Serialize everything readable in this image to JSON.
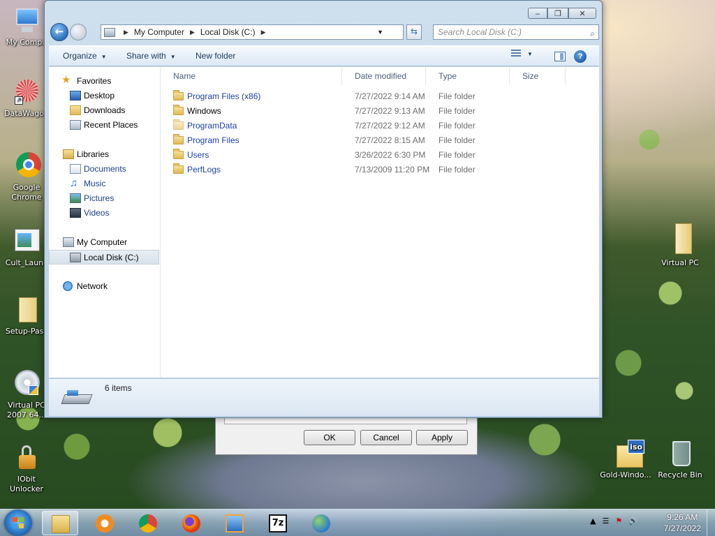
{
  "desktop": {
    "icons_left": [
      {
        "label": "My Compu",
        "icon": "my-computer-icon"
      },
      {
        "label": "DataWagon",
        "icon": "datawagon-icon"
      },
      {
        "label": "Google Chrome",
        "icon": "chrome-icon"
      },
      {
        "label": "Cult_Launc",
        "icon": "app-window-icon"
      },
      {
        "label": "Setup-Pass",
        "icon": "folder-icon"
      },
      {
        "label": "Virtual PC 2007 64...",
        "icon": "disc-installer-icon"
      },
      {
        "label": "IObit Unlocker",
        "icon": "unlocker-lock-icon"
      }
    ],
    "icons_right": [
      {
        "label": "Virtual PC",
        "icon": "folder-icon"
      },
      {
        "label": "Gold-Windo...",
        "icon": "iso-file-icon"
      },
      {
        "label": "Recycle Bin",
        "icon": "recycle-bin-icon"
      }
    ]
  },
  "back_dialog": {
    "ok": "OK",
    "cancel": "Cancel",
    "apply": "Apply"
  },
  "explorer": {
    "address": [
      "My Computer",
      "Local Disk (C:)"
    ],
    "search_placeholder": "Search Local Disk (C:)",
    "toolbar": {
      "organize": "Organize",
      "share_with": "Share with",
      "new_folder": "New folder"
    },
    "sidebar": {
      "favorites": {
        "label": "Favorites",
        "items": [
          "Desktop",
          "Downloads",
          "Recent Places"
        ]
      },
      "libraries": {
        "label": "Libraries",
        "items": [
          "Documents",
          "Music",
          "Pictures",
          "Videos"
        ]
      },
      "computer": {
        "label": "My Computer",
        "items": [
          "Local Disk (C:)"
        ]
      },
      "network": {
        "label": "Network"
      }
    },
    "columns": [
      "Name",
      "Date modified",
      "Type",
      "Size"
    ],
    "files": [
      {
        "name": "Program Files (x86)",
        "date": "7/27/2022 9:14 AM",
        "type": "File folder"
      },
      {
        "name": "Windows",
        "date": "7/27/2022 9:13 AM",
        "type": "File folder"
      },
      {
        "name": "ProgramData",
        "date": "7/27/2022 9:12 AM",
        "type": "File folder"
      },
      {
        "name": "Program Files",
        "date": "7/27/2022 8:15 AM",
        "type": "File folder"
      },
      {
        "name": "Users",
        "date": "3/26/2022 6:30 PM",
        "type": "File folder"
      },
      {
        "name": "PerfLogs",
        "date": "7/13/2009 11:20 PM",
        "type": "File folder"
      }
    ],
    "status": "6 items"
  },
  "taskbar": {
    "apps": [
      "explorer-icon",
      "media-player-icon",
      "chrome-icon",
      "firefox-icon",
      "virtual-pc-icon",
      "7zip-icon",
      "internet-download-manager-icon"
    ],
    "sevenzip_text": "7z",
    "clock_time": "9:26 AM",
    "clock_date": "7/27/2022"
  }
}
